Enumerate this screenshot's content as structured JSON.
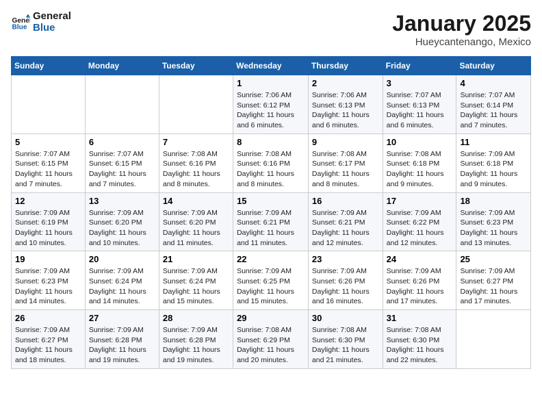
{
  "header": {
    "logo_line1": "General",
    "logo_line2": "Blue",
    "title": "January 2025",
    "subtitle": "Hueycantenango, Mexico"
  },
  "days_of_week": [
    "Sunday",
    "Monday",
    "Tuesday",
    "Wednesday",
    "Thursday",
    "Friday",
    "Saturday"
  ],
  "weeks": [
    [
      {
        "day": "",
        "info": ""
      },
      {
        "day": "",
        "info": ""
      },
      {
        "day": "",
        "info": ""
      },
      {
        "day": "1",
        "info": "Sunrise: 7:06 AM\nSunset: 6:12 PM\nDaylight: 11 hours and 6 minutes."
      },
      {
        "day": "2",
        "info": "Sunrise: 7:06 AM\nSunset: 6:13 PM\nDaylight: 11 hours and 6 minutes."
      },
      {
        "day": "3",
        "info": "Sunrise: 7:07 AM\nSunset: 6:13 PM\nDaylight: 11 hours and 6 minutes."
      },
      {
        "day": "4",
        "info": "Sunrise: 7:07 AM\nSunset: 6:14 PM\nDaylight: 11 hours and 7 minutes."
      }
    ],
    [
      {
        "day": "5",
        "info": "Sunrise: 7:07 AM\nSunset: 6:15 PM\nDaylight: 11 hours and 7 minutes."
      },
      {
        "day": "6",
        "info": "Sunrise: 7:07 AM\nSunset: 6:15 PM\nDaylight: 11 hours and 7 minutes."
      },
      {
        "day": "7",
        "info": "Sunrise: 7:08 AM\nSunset: 6:16 PM\nDaylight: 11 hours and 8 minutes."
      },
      {
        "day": "8",
        "info": "Sunrise: 7:08 AM\nSunset: 6:16 PM\nDaylight: 11 hours and 8 minutes."
      },
      {
        "day": "9",
        "info": "Sunrise: 7:08 AM\nSunset: 6:17 PM\nDaylight: 11 hours and 8 minutes."
      },
      {
        "day": "10",
        "info": "Sunrise: 7:08 AM\nSunset: 6:18 PM\nDaylight: 11 hours and 9 minutes."
      },
      {
        "day": "11",
        "info": "Sunrise: 7:09 AM\nSunset: 6:18 PM\nDaylight: 11 hours and 9 minutes."
      }
    ],
    [
      {
        "day": "12",
        "info": "Sunrise: 7:09 AM\nSunset: 6:19 PM\nDaylight: 11 hours and 10 minutes."
      },
      {
        "day": "13",
        "info": "Sunrise: 7:09 AM\nSunset: 6:20 PM\nDaylight: 11 hours and 10 minutes."
      },
      {
        "day": "14",
        "info": "Sunrise: 7:09 AM\nSunset: 6:20 PM\nDaylight: 11 hours and 11 minutes."
      },
      {
        "day": "15",
        "info": "Sunrise: 7:09 AM\nSunset: 6:21 PM\nDaylight: 11 hours and 11 minutes."
      },
      {
        "day": "16",
        "info": "Sunrise: 7:09 AM\nSunset: 6:21 PM\nDaylight: 11 hours and 12 minutes."
      },
      {
        "day": "17",
        "info": "Sunrise: 7:09 AM\nSunset: 6:22 PM\nDaylight: 11 hours and 12 minutes."
      },
      {
        "day": "18",
        "info": "Sunrise: 7:09 AM\nSunset: 6:23 PM\nDaylight: 11 hours and 13 minutes."
      }
    ],
    [
      {
        "day": "19",
        "info": "Sunrise: 7:09 AM\nSunset: 6:23 PM\nDaylight: 11 hours and 14 minutes."
      },
      {
        "day": "20",
        "info": "Sunrise: 7:09 AM\nSunset: 6:24 PM\nDaylight: 11 hours and 14 minutes."
      },
      {
        "day": "21",
        "info": "Sunrise: 7:09 AM\nSunset: 6:24 PM\nDaylight: 11 hours and 15 minutes."
      },
      {
        "day": "22",
        "info": "Sunrise: 7:09 AM\nSunset: 6:25 PM\nDaylight: 11 hours and 15 minutes."
      },
      {
        "day": "23",
        "info": "Sunrise: 7:09 AM\nSunset: 6:26 PM\nDaylight: 11 hours and 16 minutes."
      },
      {
        "day": "24",
        "info": "Sunrise: 7:09 AM\nSunset: 6:26 PM\nDaylight: 11 hours and 17 minutes."
      },
      {
        "day": "25",
        "info": "Sunrise: 7:09 AM\nSunset: 6:27 PM\nDaylight: 11 hours and 17 minutes."
      }
    ],
    [
      {
        "day": "26",
        "info": "Sunrise: 7:09 AM\nSunset: 6:27 PM\nDaylight: 11 hours and 18 minutes."
      },
      {
        "day": "27",
        "info": "Sunrise: 7:09 AM\nSunset: 6:28 PM\nDaylight: 11 hours and 19 minutes."
      },
      {
        "day": "28",
        "info": "Sunrise: 7:09 AM\nSunset: 6:28 PM\nDaylight: 11 hours and 19 minutes."
      },
      {
        "day": "29",
        "info": "Sunrise: 7:08 AM\nSunset: 6:29 PM\nDaylight: 11 hours and 20 minutes."
      },
      {
        "day": "30",
        "info": "Sunrise: 7:08 AM\nSunset: 6:30 PM\nDaylight: 11 hours and 21 minutes."
      },
      {
        "day": "31",
        "info": "Sunrise: 7:08 AM\nSunset: 6:30 PM\nDaylight: 11 hours and 22 minutes."
      },
      {
        "day": "",
        "info": ""
      }
    ]
  ]
}
